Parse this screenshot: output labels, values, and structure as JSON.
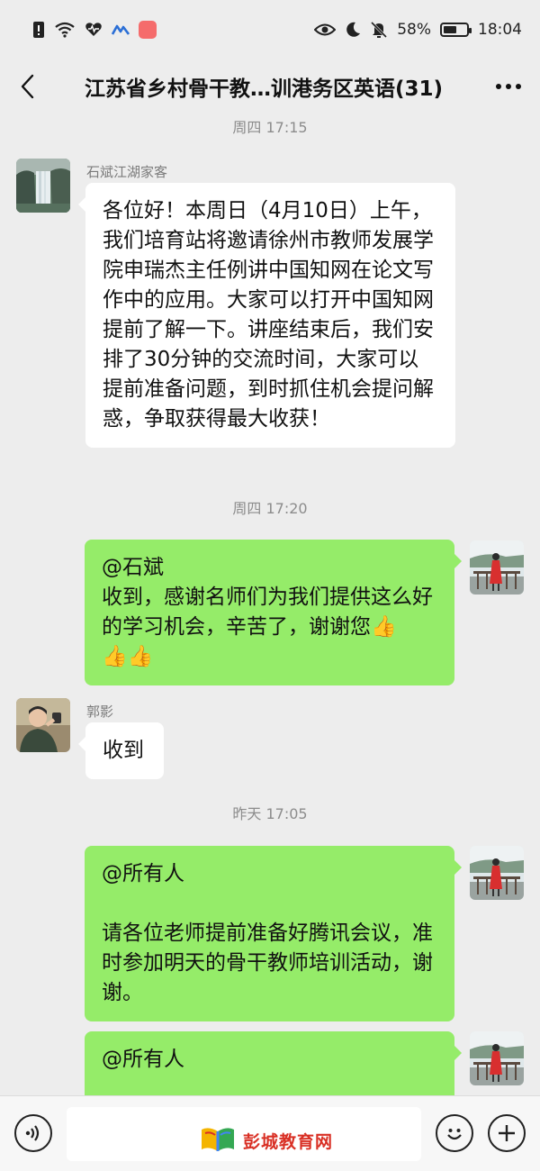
{
  "status_bar": {
    "battery_text": "58%",
    "battery_level": 0.58,
    "time": "18:04",
    "icons": [
      "alert-icon",
      "wifi-icon",
      "heart-icon",
      "app-icon",
      "red-app-icon",
      "eye-icon",
      "moon-icon",
      "mute-icon",
      "battery-icon"
    ]
  },
  "header": {
    "title": "江苏省乡村骨干教…训港务区英语(31)",
    "back_icon": "back-arrow-icon",
    "more_icon": "more-icon"
  },
  "messages": [
    {
      "type": "timestamp",
      "text": "周四 17:15"
    },
    {
      "type": "incoming",
      "sender": "石斌江湖家客",
      "text": "各位好！本周日（4月10日）上午，我们培育站将邀请徐州市教师发展学院申瑞杰主任例讲中国知网在论文写作中的应用。大家可以打开中国知网提前了解一下。讲座结束后，我们安排了30分钟的交流时间，大家可以提前准备问题，到时抓住机会提问解惑，争取获得最大收获！"
    },
    {
      "type": "timestamp",
      "text": "周四 17:20"
    },
    {
      "type": "outgoing",
      "text": "@石斌\n收到，感谢名师们为我们提供这么好的学习机会，辛苦了，谢谢您👍\n👍👍"
    },
    {
      "type": "incoming",
      "sender": "郭影",
      "text": "收到"
    },
    {
      "type": "timestamp",
      "text": "昨天 17:05"
    },
    {
      "type": "outgoing",
      "text": "@所有人\n\n请各位老师提前准备好腾讯会议，准时参加明天的骨干教师培训活动，谢谢。"
    },
    {
      "type": "outgoing",
      "text": "@所有人"
    }
  ],
  "input_bar": {
    "placeholder": "",
    "voice_icon": "voice-icon",
    "emoji_icon": "emoji-icon",
    "plus_icon": "plus-icon"
  },
  "watermark": {
    "text": "彭城教育网"
  },
  "colors": {
    "background": "#ededed",
    "incoming_bubble": "#ffffff",
    "outgoing_bubble": "#95ec69"
  }
}
